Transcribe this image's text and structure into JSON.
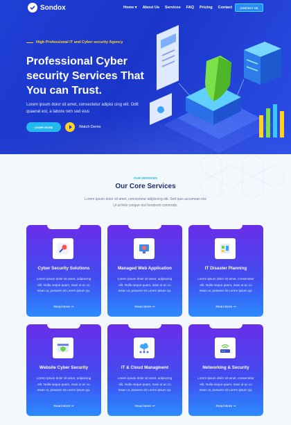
{
  "brand": {
    "name": "Sondox"
  },
  "nav": {
    "items": [
      "Home ▾",
      "About Us",
      "Services",
      "FAQ",
      "Pricing",
      "Contact"
    ],
    "cta": "CONTACT US"
  },
  "hero": {
    "tagline": "High Professional IT and Cyber security Agency",
    "title": "Professional Cyber security Services That You can Trust.",
    "description": "Lorem ipsum dolor sit amet, consectetur adipisi cing elit. Odit quaerat est, a labore rem sed eius",
    "primary_button": "LEARN MORE",
    "video_label": "Watch Demo"
  },
  "services": {
    "kicker": "OUR SERVICES",
    "title": "Our Core Services",
    "description": "Lorem ipsum dolor sit amet, consectetur adipiscing elit. Sed quis accumsan nisi Ut ut felis congue nisl hendrerit commodo.",
    "cards": [
      {
        "title": "Cyber Security Solutions",
        "icon": "magnifier-icon",
        "text": "Lorem ipsum dolor sit amet, adipiscing elit. Nulla neque quam, maxi ut ac cu msan ut, posuere sit Lorem ipsum qu.",
        "link": "Read More ➞"
      },
      {
        "title": "Managed Web Application",
        "icon": "monitor-settings-icon",
        "text": "Lorem ipsum dolor sit amet, adipiscing elit. Nulla neque quam, maxi ut ac cu msan ut, posuere sit Lorem ipsum qu.",
        "link": "Read More ➞"
      },
      {
        "title": "IT Disaster Planning",
        "icon": "planning-board-icon",
        "text": "Lorem ipsum dolor sit amet, consectetur elit. Nulla neque quam, maxi ut ac cu msan ut, posuere sit Lorem ipsum qu.",
        "link": "Read More ➞"
      },
      {
        "title": "Website Cyber Security",
        "icon": "browser-shield-icon",
        "text": "Lorem ipsum dolor sit amet, adipiscing elit. Nulla neque quam, maxi ut ac cu msan ut, posuere sit Lorem ipsum qu.",
        "link": "Read More ➞"
      },
      {
        "title": "IT & Cloud Managment",
        "icon": "cloud-network-icon",
        "text": "Lorem ipsum dolor sit amet, adipiscing elit. Nulla neque quam, maxi ut ac cu msan ut, posuere sit Lorem ipsum qu.",
        "link": "Read More ➞"
      },
      {
        "title": "Networking & Security",
        "icon": "router-wifi-icon",
        "text": "Lorem ipsum dolor sit amet, consectetur elit. Nulla neque quam, maxi ut ac cu msan ut, posuere sit Lorem ipsum qu.",
        "link": "Read More ➞"
      }
    ]
  },
  "colors": {
    "hero_blue": "#1f3fd6",
    "accent_yellow": "#ffd21f",
    "accent_cyan": "#22b8f0",
    "card_purple": "#6a2de8",
    "card_blue": "#2c8bff",
    "heading_navy": "#1b2d6e"
  }
}
